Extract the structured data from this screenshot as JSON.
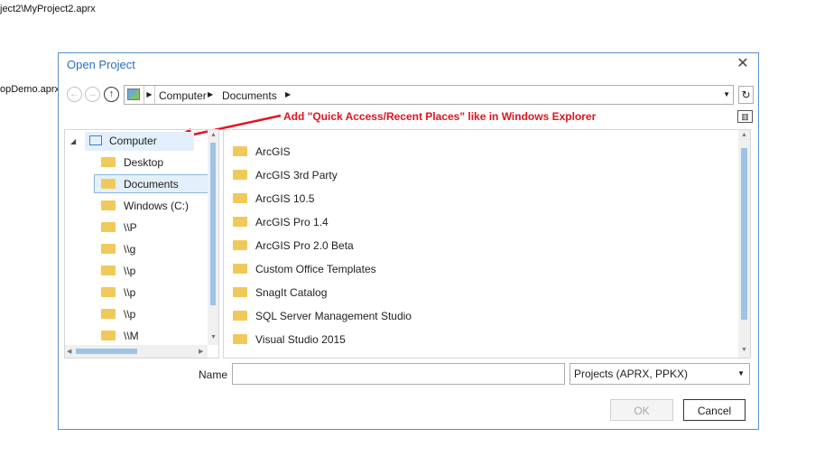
{
  "background": {
    "path_1": "ject2\\MyProject2.aprx",
    "path_2": "opDemo.aprx"
  },
  "dialog": {
    "title": "Open Project",
    "close_glyph": "✕",
    "accent_color": "#2a6fbd"
  },
  "nav": {
    "back_glyph": "←",
    "forward_glyph": "→",
    "up_glyph": "↑"
  },
  "address": {
    "crumbs": [
      "Computer",
      "Documents"
    ],
    "arrow_glyph": "▶",
    "dropdown_glyph": "▼",
    "refresh_glyph": "↻"
  },
  "annotation": {
    "text": "Add \"Quick Access/Recent Places\" like in Windows Explorer",
    "color": "#e0141e"
  },
  "tree": {
    "expander_glyph": "◢",
    "items": [
      {
        "label": "Computer",
        "type": "computer"
      },
      {
        "label": "Desktop",
        "type": "folder"
      },
      {
        "label": "Documents",
        "type": "folder",
        "selected": true
      },
      {
        "label": "Windows (C:)",
        "type": "folder"
      },
      {
        "label": "\\\\P",
        "type": "folder"
      },
      {
        "label": "\\\\g",
        "type": "folder"
      },
      {
        "label": "\\\\p",
        "type": "folder"
      },
      {
        "label": "\\\\p",
        "type": "folder"
      },
      {
        "label": "\\\\p",
        "type": "folder"
      },
      {
        "label": "\\\\M",
        "type": "folder"
      }
    ]
  },
  "list": {
    "items": [
      "ArcGIS",
      "ArcGIS 3rd Party",
      "ArcGIS 10.5",
      "ArcGIS Pro 1.4",
      "ArcGIS Pro 2.0 Beta",
      "Custom Office Templates",
      "SnagIt Catalog",
      "SQL Server Management Studio",
      "Visual Studio 2015"
    ]
  },
  "footer": {
    "name_label": "Name",
    "name_value": "",
    "filetype_value": "Projects (APRX, PPKX)",
    "ok_label": "OK",
    "cancel_label": "Cancel"
  },
  "scroll_glyphs": {
    "up": "▲",
    "down": "▼",
    "left": "◀",
    "right": "▶"
  }
}
